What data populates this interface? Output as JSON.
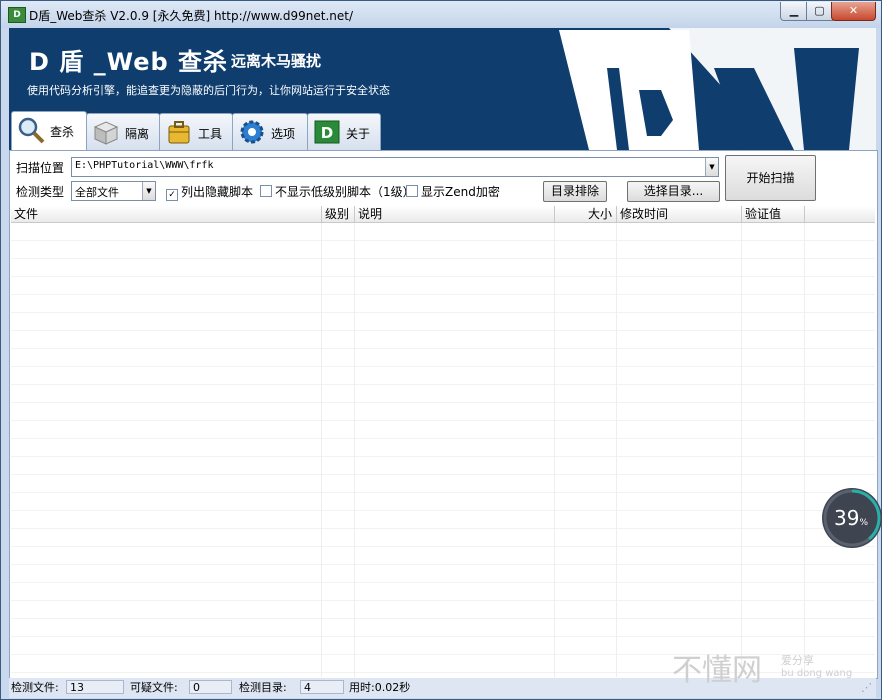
{
  "window": {
    "title": "D盾_Web查杀 V2.0.9 [永久免费] http://www.d99net.net/",
    "min_glyph": "▁",
    "max_glyph": "▢",
    "close_glyph": "✕"
  },
  "banner": {
    "title": "D 盾 _Web 查杀",
    "subtitle": "远离木马骚扰",
    "description": "使用代码分析引擎，能追查更为隐蔽的后门行为，让你网站运行于安全状态",
    "logo_text": "D"
  },
  "tabs": [
    {
      "label": "查杀",
      "icon": "magnifier-icon"
    },
    {
      "label": "隔离",
      "icon": "box-icon"
    },
    {
      "label": "工具",
      "icon": "toolbox-icon"
    },
    {
      "label": "选项",
      "icon": "gear-icon"
    },
    {
      "label": "关于",
      "icon": "d-logo-icon"
    }
  ],
  "scan": {
    "location_label": "扫描位置",
    "location_value": "E:\\PHPTutorial\\WWW\\frfk",
    "type_label": "检测类型",
    "type_value": "全部文件",
    "opt_hidden": {
      "label": "列出隐藏脚本",
      "checked": true
    },
    "opt_lowlevel": {
      "label": "不显示低级别脚本（1级）",
      "checked": false
    },
    "opt_zend": {
      "label": "显示Zend加密",
      "checked": false
    },
    "exclude_button": "目录排除",
    "select_dir_button": "选择目录...",
    "start_button": "开始扫描"
  },
  "grid": {
    "columns": [
      "文件",
      "级别",
      "说明",
      "大小",
      "修改时间",
      "验证值"
    ]
  },
  "status": {
    "files_label": "检测文件:",
    "files_value": "13",
    "suspicious_label": "可疑文件:",
    "suspicious_value": "0",
    "dirs_label": "检测目录:",
    "dirs_value": "4",
    "time_text": "用时:0.02秒"
  },
  "overlay": {
    "progress_percent": 39,
    "progress_value": "39",
    "progress_unit": "%",
    "watermark": "不懂网",
    "watermark_sub": "爱分享",
    "watermark_pinyin": "bu dong wang"
  },
  "colors": {
    "banner_bg": "#0e3d6e",
    "progress_ring": "#27b0a8"
  }
}
